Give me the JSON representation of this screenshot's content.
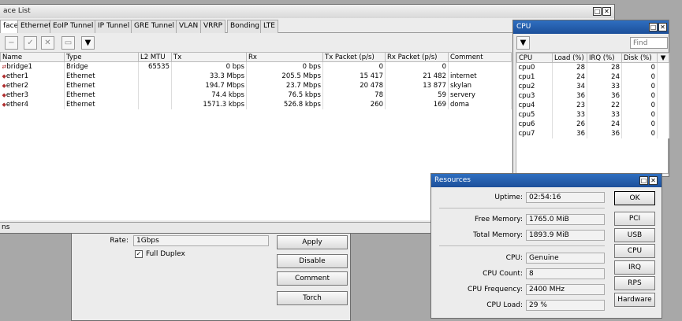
{
  "iface_window": {
    "title": "ace List",
    "tabs": [
      "face",
      "Ethernet",
      "EoIP Tunnel",
      "IP Tunnel",
      "GRE Tunnel",
      "VLAN",
      "VRRP",
      "Bonding",
      "LTE"
    ],
    "columns": [
      "Name",
      "Type",
      "L2 MTU",
      "Tx",
      "Rx",
      "Tx Packet (p/s)",
      "Rx Packet (p/s)",
      "Comment"
    ],
    "rows": [
      {
        "name": "bridge1",
        "type": "Bridge",
        "mtu": "65535",
        "tx": "0 bps",
        "rx": "0 bps",
        "txp": "0",
        "rxp": "0",
        "comment": ""
      },
      {
        "name": "ether1",
        "type": "Ethernet",
        "mtu": "",
        "tx": "33.3 Mbps",
        "rx": "205.5 Mbps",
        "txp": "15 417",
        "rxp": "21 482",
        "comment": "internet"
      },
      {
        "name": "ether2",
        "type": "Ethernet",
        "mtu": "",
        "tx": "194.7 Mbps",
        "rx": "23.7 Mbps",
        "txp": "20 478",
        "rxp": "13 877",
        "comment": "skylan"
      },
      {
        "name": "ether3",
        "type": "Ethernet",
        "mtu": "",
        "tx": "74.4 kbps",
        "rx": "76.5 kbps",
        "txp": "78",
        "rxp": "59",
        "comment": "servery"
      },
      {
        "name": "ether4",
        "type": "Ethernet",
        "mtu": "",
        "tx": "1571.3 kbps",
        "rx": "526.8 kbps",
        "txp": "260",
        "rxp": "169",
        "comment": "doma"
      }
    ],
    "status": "ns"
  },
  "ether_window": {
    "rate_label": "Rate:",
    "rate_value": "1Gbps",
    "full_duplex": "Full Duplex",
    "buttons": [
      "Apply",
      "Disable",
      "Comment",
      "Torch"
    ]
  },
  "cpu_window": {
    "title": "CPU",
    "find_placeholder": "Find",
    "columns": [
      "CPU",
      "Load (%)",
      "IRQ (%)",
      "Disk (%)"
    ],
    "rows": [
      [
        "cpu0",
        "28",
        "28",
        "0"
      ],
      [
        "cpu1",
        "24",
        "24",
        "0"
      ],
      [
        "cpu2",
        "34",
        "33",
        "0"
      ],
      [
        "cpu3",
        "36",
        "36",
        "0"
      ],
      [
        "cpu4",
        "23",
        "22",
        "0"
      ],
      [
        "cpu5",
        "33",
        "33",
        "0"
      ],
      [
        "cpu6",
        "26",
        "24",
        "0"
      ],
      [
        "cpu7",
        "36",
        "36",
        "0"
      ]
    ]
  },
  "resources": {
    "title": "Resources",
    "uptime_label": "Uptime:",
    "uptime": "02:54:16",
    "free_mem_label": "Free Memory:",
    "free_mem": "1765.0 MiB",
    "total_mem_label": "Total Memory:",
    "total_mem": "1893.9 MiB",
    "cpu_label": "CPU:",
    "cpu": "Genuine",
    "cpu_count_label": "CPU Count:",
    "cpu_count": "8",
    "cpu_freq_label": "CPU Frequency:",
    "cpu_freq": "2400 MHz",
    "cpu_load_label": "CPU Load:",
    "cpu_load": "29 %",
    "buttons": [
      "OK",
      "PCI",
      "USB",
      "CPU",
      "IRQ",
      "RPS",
      "Hardware"
    ]
  }
}
